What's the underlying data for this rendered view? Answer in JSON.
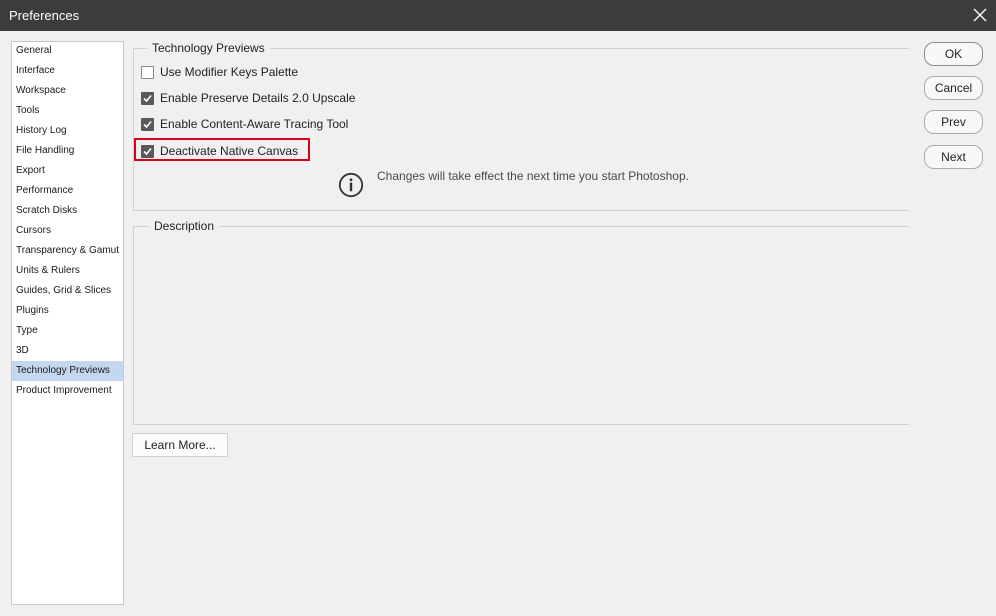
{
  "window": {
    "title": "Preferences",
    "close_icon": "close-icon"
  },
  "sidebar": {
    "items": [
      {
        "label": "General"
      },
      {
        "label": "Interface"
      },
      {
        "label": "Workspace"
      },
      {
        "label": "Tools"
      },
      {
        "label": "History Log"
      },
      {
        "label": "File Handling"
      },
      {
        "label": "Export"
      },
      {
        "label": "Performance"
      },
      {
        "label": "Scratch Disks"
      },
      {
        "label": "Cursors"
      },
      {
        "label": "Transparency & Gamut"
      },
      {
        "label": "Units & Rulers"
      },
      {
        "label": "Guides, Grid & Slices"
      },
      {
        "label": "Plugins"
      },
      {
        "label": "Type"
      },
      {
        "label": "3D"
      },
      {
        "label": "Technology Previews"
      },
      {
        "label": "Product Improvement"
      }
    ],
    "selected_index": 16,
    "selected_color": "#c3d7ee"
  },
  "tech_previews": {
    "group_title": "Technology Previews",
    "options": [
      {
        "label": "Use Modifier Keys Palette",
        "checked": false
      },
      {
        "label": "Enable Preserve Details 2.0 Upscale",
        "checked": true
      },
      {
        "label": "Enable Content-Aware Tracing Tool",
        "checked": true
      },
      {
        "label": "Deactivate Native Canvas",
        "checked": true
      }
    ],
    "highlight_color": "#d9001b",
    "info_icon": "info-icon",
    "info_text": "Changes will take effect the next time you start Photoshop."
  },
  "description": {
    "group_title": "Description"
  },
  "buttons": {
    "ok": "OK",
    "cancel": "Cancel",
    "prev": "Prev",
    "next": "Next",
    "learn_more": "Learn More..."
  }
}
